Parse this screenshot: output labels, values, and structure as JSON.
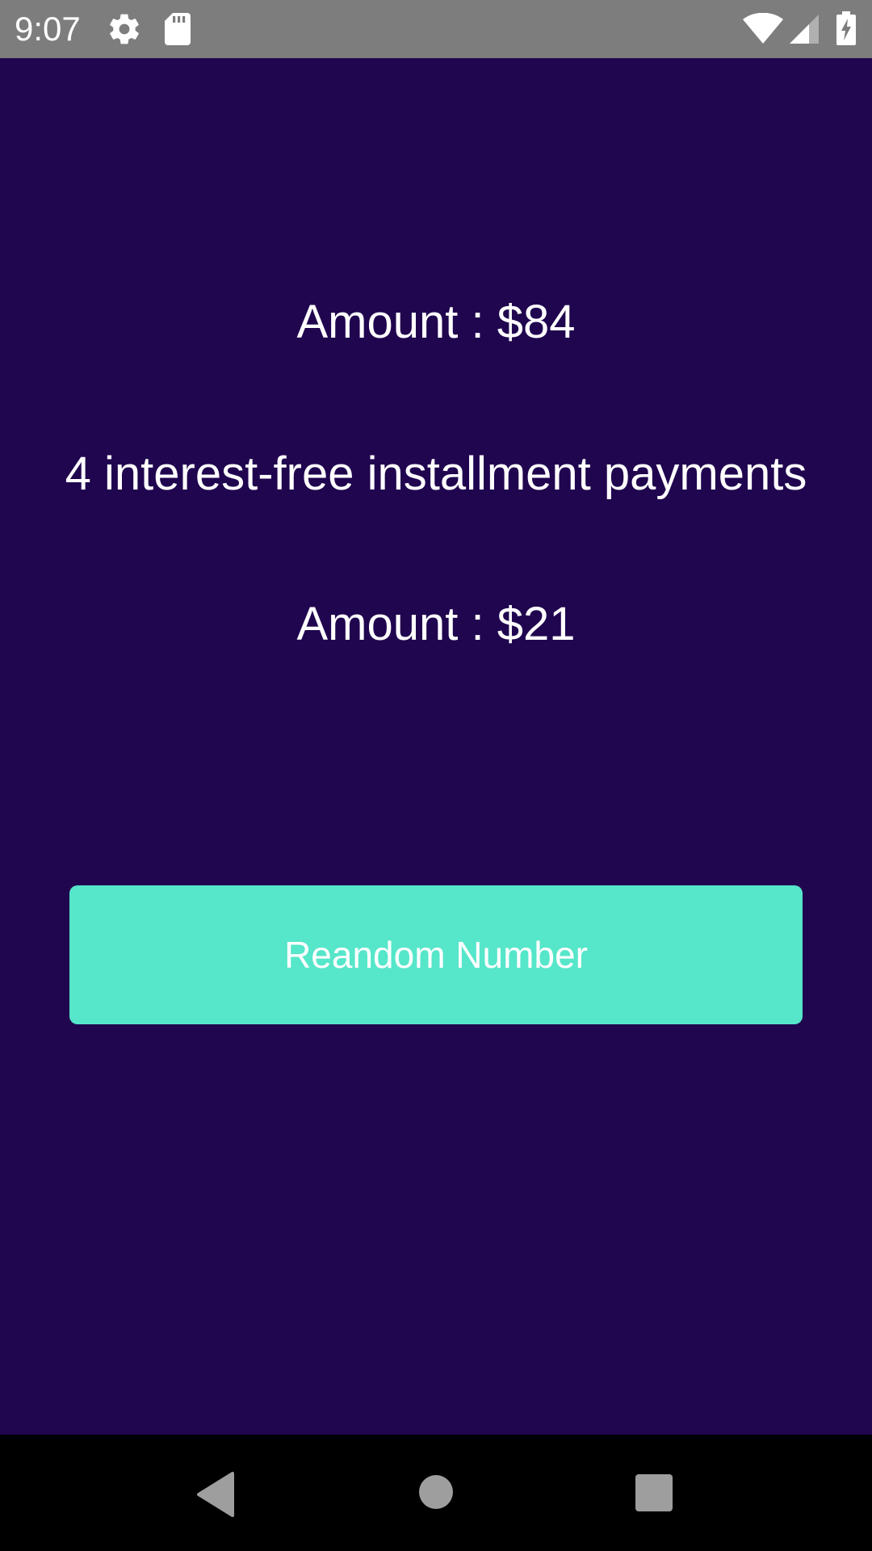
{
  "status_bar": {
    "time": "9:07",
    "icons": [
      "gear-icon",
      "sd-card-icon",
      "wifi-icon",
      "signal-icon",
      "battery-charging-icon"
    ]
  },
  "main": {
    "total_amount": "Amount : $84",
    "installments_label": "4 interest-free installment payments",
    "installment_amount": "Amount : $21",
    "button_label": "Reandom Number"
  },
  "nav_bar": {
    "icons": [
      "back-icon",
      "home-icon",
      "recents-icon"
    ]
  },
  "colors": {
    "background": "#20054f",
    "button": "#56e6ca",
    "status_bar": "#7d7d7d",
    "nav_bar": "#000000",
    "text": "#ffffff"
  }
}
